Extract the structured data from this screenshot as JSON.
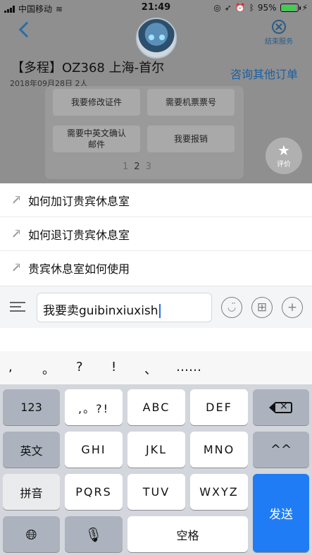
{
  "status_bar": {
    "carrier": "中国移动",
    "time": "21:49",
    "battery": "95%"
  },
  "header": {
    "end_service": "结束服务",
    "order_title": "【多程】OZ368   上海-首尔",
    "order_sub": "2018年09月28日 2人",
    "consult_other": "咨询其他订单"
  },
  "quick_actions": {
    "items": [
      "我要修改证件",
      "需要机票票号",
      "需要中英文确认邮件",
      "我要报销"
    ],
    "pages": [
      "1",
      "2",
      "3"
    ],
    "rate_label": "评价"
  },
  "suggestions": [
    "如何加订贵宾休息室",
    "如何退订贵宾休息室",
    "贵宾休息室如何使用"
  ],
  "composer": {
    "text": "我要卖guibinxiuxish"
  },
  "candidates": [
    ",",
    "。",
    "?",
    "!",
    "、",
    "……"
  ],
  "keyboard": {
    "row1": [
      "123",
      ",。?!",
      "ABC",
      "DEF"
    ],
    "row2": [
      "英文",
      "GHI",
      "JKL",
      "MNO",
      "^^"
    ],
    "row3": [
      "拼音",
      "PQRS",
      "TUV",
      "WXYZ"
    ],
    "send": "发送",
    "space": "空格"
  },
  "colors": {
    "accent": "#1f7cf4",
    "link": "#1c5fa0"
  }
}
